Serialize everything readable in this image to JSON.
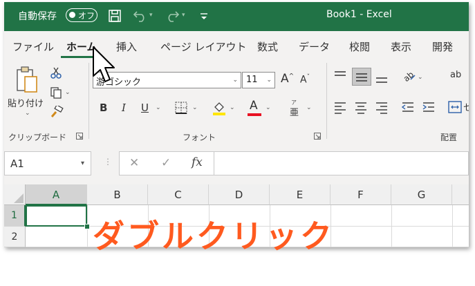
{
  "titlebar": {
    "autosave_label": "自動保存",
    "autosave_state": "オフ",
    "save_icon": "save-icon",
    "undo_icon": "undo-icon",
    "redo_icon": "redo-icon",
    "customize_icon": "customize-qat-icon",
    "window_title": "Book1  -  Excel"
  },
  "tabs": [
    {
      "label": "ファイル"
    },
    {
      "label": "ホーム"
    },
    {
      "label": "挿入"
    },
    {
      "label": "ページ レイアウト"
    },
    {
      "label": "数式"
    },
    {
      "label": "データ"
    },
    {
      "label": "校閲"
    },
    {
      "label": "表示"
    },
    {
      "label": "開発"
    }
  ],
  "ribbon": {
    "clipboard": {
      "paste_label": "貼り付け",
      "group_label": "クリップボード"
    },
    "font": {
      "font_name": "游ゴシック",
      "font_size": "11",
      "bold": "B",
      "italic": "I",
      "underline": "U",
      "furigana": "亜",
      "grow_font": "A",
      "shrink_font": "A",
      "font_color_letter": "A",
      "group_label": "フォント"
    },
    "alignment": {
      "group_label": "配置",
      "wrap_partial": "ab"
    }
  },
  "formula_bar": {
    "name_box": "A1",
    "cancel_glyph": "✕",
    "enter_glyph": "✓",
    "fx": "fx",
    "value": ""
  },
  "grid": {
    "columns": [
      "A",
      "B",
      "C",
      "D",
      "E",
      "F",
      "G"
    ],
    "rows": [
      "1",
      "2"
    ],
    "selected_cell": "A1"
  },
  "overlay": {
    "text": "ダブルクリック"
  },
  "colors": {
    "excel_green": "#217346",
    "overlay_orange": "#ff5a1f"
  }
}
